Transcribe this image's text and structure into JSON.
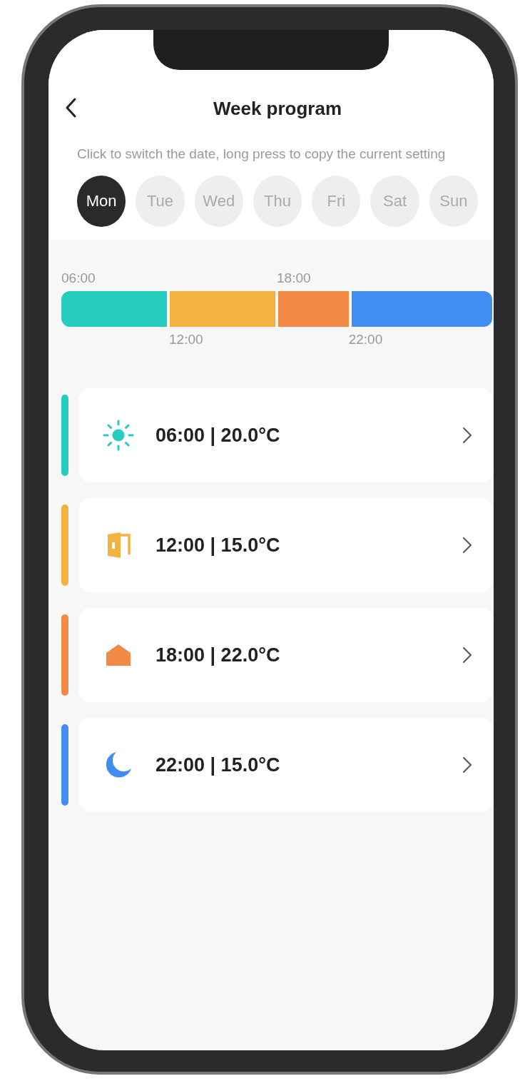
{
  "header": {
    "title": "Week program"
  },
  "hint": "Click to switch the date, long press to copy the current setting",
  "days": [
    {
      "label": "Mon",
      "selected": true
    },
    {
      "label": "Tue",
      "selected": false
    },
    {
      "label": "Wed",
      "selected": false
    },
    {
      "label": "Thu",
      "selected": false
    },
    {
      "label": "Fri",
      "selected": false
    },
    {
      "label": "Sat",
      "selected": false
    },
    {
      "label": "Sun",
      "selected": false
    }
  ],
  "timeline": [
    {
      "time": "06:00",
      "color": "#26cdbf"
    },
    {
      "time": "12:00",
      "color": "#f2b340"
    },
    {
      "time": "18:00",
      "color": "#f28a45"
    },
    {
      "time": "22:00",
      "color": "#418ef2"
    }
  ],
  "periods": [
    {
      "kind": "sun",
      "label": "06:00 | 20.0°C",
      "color": "#26cdbf"
    },
    {
      "kind": "door",
      "label": "12:00 | 15.0°C",
      "color": "#f2b340"
    },
    {
      "kind": "home",
      "label": "18:00 | 22.0°C",
      "color": "#f28a45"
    },
    {
      "kind": "moon",
      "label": "22:00 | 15.0°C",
      "color": "#418ef2"
    }
  ]
}
